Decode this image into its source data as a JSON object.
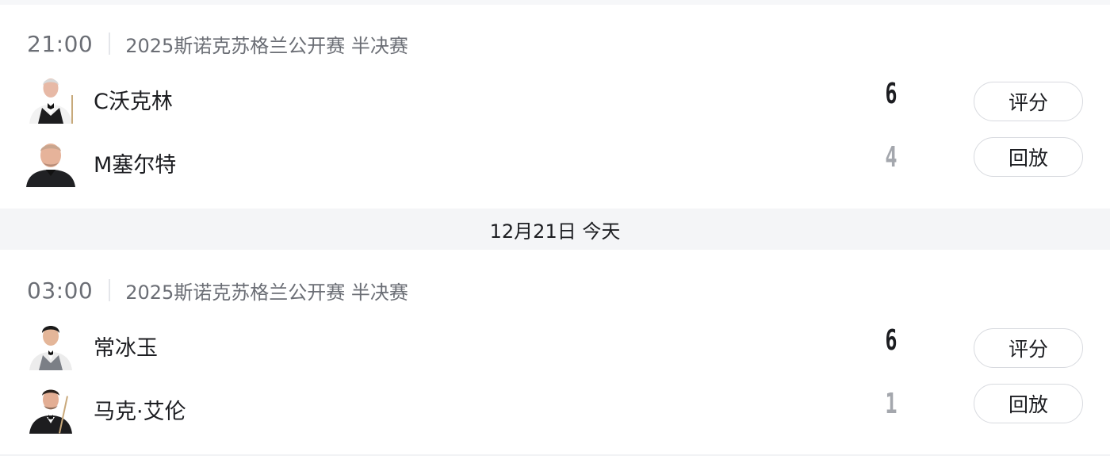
{
  "matches": [
    {
      "time": "21:00",
      "title": "2025斯诺克苏格兰公开赛 半决赛",
      "players": [
        {
          "name": "C沃克林",
          "score": "6",
          "avatar": "player-avatar",
          "action": "评分",
          "winner": true
        },
        {
          "name": "M塞尔特",
          "score": "4",
          "avatar": "player-avatar",
          "action": "回放",
          "winner": false
        }
      ]
    },
    {
      "time": "03:00",
      "title": "2025斯诺克苏格兰公开赛 半决赛",
      "players": [
        {
          "name": "常冰玉",
          "score": "6",
          "avatar": "player-avatar",
          "action": "评分",
          "winner": true
        },
        {
          "name": "马克·艾伦",
          "score": "1",
          "avatar": "player-avatar",
          "action": "回放",
          "winner": false
        }
      ]
    }
  ],
  "date_separator": "12月21日 今天",
  "colors": {
    "text_primary": "#1c1d21",
    "text_secondary": "#6b6e75",
    "score_loser": "#a4a7ad",
    "separator_bg": "#f4f5f7",
    "button_border": "#d8dadf"
  }
}
